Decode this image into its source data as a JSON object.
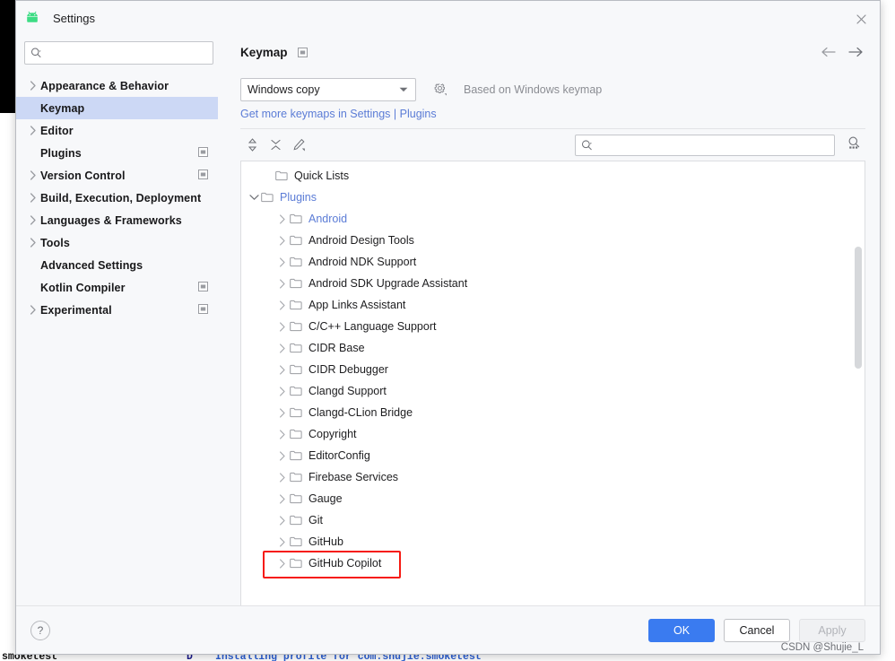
{
  "window": {
    "title": "Settings",
    "app_icon": "android-icon",
    "close_icon": "close-icon"
  },
  "sidebar": {
    "search": {
      "value": "",
      "placeholder": "",
      "icon": "search-icon"
    },
    "items": [
      {
        "label": "Appearance & Behavior",
        "expandable": true,
        "selected": false,
        "module_icon": false
      },
      {
        "label": "Keymap",
        "expandable": false,
        "selected": true,
        "module_icon": false
      },
      {
        "label": "Editor",
        "expandable": true,
        "selected": false,
        "module_icon": false
      },
      {
        "label": "Plugins",
        "expandable": false,
        "selected": false,
        "module_icon": true
      },
      {
        "label": "Version Control",
        "expandable": true,
        "selected": false,
        "module_icon": true
      },
      {
        "label": "Build, Execution, Deployment",
        "expandable": true,
        "selected": false,
        "module_icon": false
      },
      {
        "label": "Languages & Frameworks",
        "expandable": true,
        "selected": false,
        "module_icon": false
      },
      {
        "label": "Tools",
        "expandable": true,
        "selected": false,
        "module_icon": false
      },
      {
        "label": "Advanced Settings",
        "expandable": false,
        "selected": false,
        "module_icon": false
      },
      {
        "label": "Kotlin Compiler",
        "expandable": false,
        "selected": false,
        "module_icon": true
      },
      {
        "label": "Experimental",
        "expandable": true,
        "selected": false,
        "module_icon": true
      }
    ]
  },
  "content": {
    "page_title": "Keymap",
    "nav_back_icon": "arrow-left-icon",
    "nav_forward_icon": "arrow-right-icon",
    "keymap_select": {
      "value": "Windows copy",
      "caret_icon": "chevron-down-icon"
    },
    "gear_icon": "gear-icon",
    "based_on_text": "Based on Windows keymap",
    "get_more_link": "Get more keymaps in Settings | Plugins",
    "toolbar": {
      "expand_collapse_icon": "expand-collapse-icon",
      "collapse_all_icon": "collapse-all-icon",
      "edit_shortcut_icon": "edit-pencil-icon",
      "search": {
        "value": "",
        "placeholder": "",
        "icon": "search-icon"
      },
      "find_by_shortcut_icon": "keyboard-shortcut-search-icon"
    },
    "tree": [
      {
        "label": "Quick Lists",
        "level": 0,
        "expandable": false,
        "expanded": false,
        "link": false,
        "highlighted": false
      },
      {
        "label": "Plugins",
        "level": 0,
        "expandable": true,
        "expanded": true,
        "link": true,
        "highlighted": false
      },
      {
        "label": "Android",
        "level": 1,
        "expandable": true,
        "expanded": false,
        "link": true,
        "highlighted": false
      },
      {
        "label": "Android Design Tools",
        "level": 1,
        "expandable": true,
        "expanded": false,
        "link": false,
        "highlighted": false
      },
      {
        "label": "Android NDK Support",
        "level": 1,
        "expandable": true,
        "expanded": false,
        "link": false,
        "highlighted": false
      },
      {
        "label": "Android SDK Upgrade Assistant",
        "level": 1,
        "expandable": true,
        "expanded": false,
        "link": false,
        "highlighted": false
      },
      {
        "label": "App Links Assistant",
        "level": 1,
        "expandable": true,
        "expanded": false,
        "link": false,
        "highlighted": false
      },
      {
        "label": "C/C++ Language Support",
        "level": 1,
        "expandable": true,
        "expanded": false,
        "link": false,
        "highlighted": false
      },
      {
        "label": "CIDR Base",
        "level": 1,
        "expandable": true,
        "expanded": false,
        "link": false,
        "highlighted": false
      },
      {
        "label": "CIDR Debugger",
        "level": 1,
        "expandable": true,
        "expanded": false,
        "link": false,
        "highlighted": false
      },
      {
        "label": "Clangd Support",
        "level": 1,
        "expandable": true,
        "expanded": false,
        "link": false,
        "highlighted": false
      },
      {
        "label": "Clangd-CLion Bridge",
        "level": 1,
        "expandable": true,
        "expanded": false,
        "link": false,
        "highlighted": false
      },
      {
        "label": "Copyright",
        "level": 1,
        "expandable": true,
        "expanded": false,
        "link": false,
        "highlighted": false
      },
      {
        "label": "EditorConfig",
        "level": 1,
        "expandable": true,
        "expanded": false,
        "link": false,
        "highlighted": false
      },
      {
        "label": "Firebase Services",
        "level": 1,
        "expandable": true,
        "expanded": false,
        "link": false,
        "highlighted": false
      },
      {
        "label": "Gauge",
        "level": 1,
        "expandable": true,
        "expanded": false,
        "link": false,
        "highlighted": false
      },
      {
        "label": "Git",
        "level": 1,
        "expandable": true,
        "expanded": false,
        "link": false,
        "highlighted": false
      },
      {
        "label": "GitHub",
        "level": 1,
        "expandable": true,
        "expanded": false,
        "link": false,
        "highlighted": false
      },
      {
        "label": "GitHub Copilot",
        "level": 1,
        "expandable": true,
        "expanded": false,
        "link": false,
        "highlighted": true
      }
    ]
  },
  "footer": {
    "help_label": "?",
    "ok_label": "OK",
    "cancel_label": "Cancel",
    "apply_label": "Apply",
    "watermark": "CSDN @Shujie_L"
  },
  "background": {
    "log_left": "smoketest",
    "log_marker": "D",
    "log_message": "Installing profile for com.shujie.smoketest"
  },
  "colors": {
    "accent": "#3a7bf0",
    "selection": "#ccd8f5",
    "link": "#5b7cd6",
    "highlight_box": "#f61a12",
    "dialog_bg": "#f7f8fa"
  }
}
